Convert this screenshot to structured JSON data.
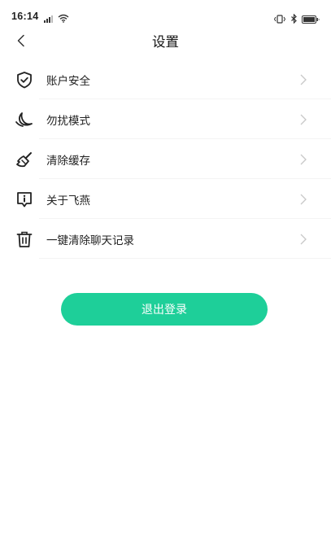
{
  "status_bar": {
    "time": "16:14",
    "icons": [
      "signal-icon",
      "wifi-icon",
      "vibrate-icon",
      "bluetooth-icon",
      "battery-icon"
    ]
  },
  "header": {
    "title": "设置",
    "back_icon": "back-arrow-icon"
  },
  "menu": {
    "items": [
      {
        "label": "账户安全",
        "icon": "shield-icon"
      },
      {
        "label": "勿扰模式",
        "icon": "moon-icon"
      },
      {
        "label": "清除缓存",
        "icon": "broom-icon"
      },
      {
        "label": "关于飞燕",
        "icon": "info-icon"
      },
      {
        "label": "一键清除聊天记录",
        "icon": "trash-icon"
      }
    ]
  },
  "logout": {
    "label": "退出登录"
  },
  "colors": {
    "accent": "#1ecf99",
    "text": "#222222",
    "chevron": "#c8c8c8"
  }
}
